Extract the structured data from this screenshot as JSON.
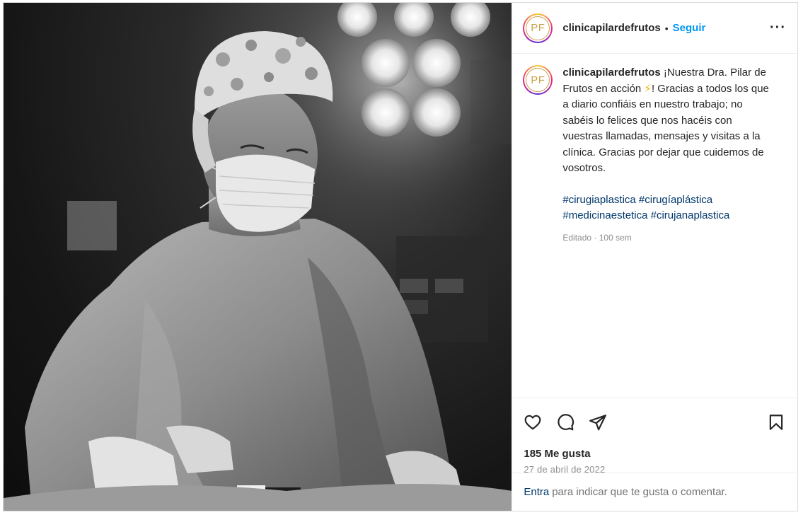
{
  "post": {
    "username": "clinicapilardefrutos",
    "avatar_initials": "PF",
    "separator": "•",
    "follow_label": "Seguir",
    "more_label": "···"
  },
  "caption": {
    "username": "clinicapilardefrutos",
    "text_before_emoji": "¡Nuestra Dra. Pilar de Frutos en acción",
    "emoji": "⚡",
    "text_after_emoji": "! Gracias a todos los que a diario confiáis en nuestro trabajo; no sabéis lo felices que nos hacéis con vuestras llamadas, mensajes y visitas a la clínica. Gracias por dejar que cuidemos de vosotros.",
    "hashtags": [
      "#cirugiaplastica",
      "#cirugíaplástica",
      "#medicinaestetica",
      "#cirujanaplastica"
    ],
    "meta": "Editado · 100 sem"
  },
  "engagement": {
    "likes": "185 Me gusta",
    "date": "27 de abril de 2022"
  },
  "footer": {
    "login_link": "Entra",
    "rest": "para indicar que te gusta o comentar."
  },
  "icons": {
    "like": "heart-icon",
    "comment": "comment-icon",
    "share": "share-icon",
    "save": "bookmark-icon"
  },
  "colors": {
    "accent": "#0095f6",
    "hashtag": "#00376b",
    "muted": "#8e8e8e",
    "logo_gold": "#c9a24a"
  }
}
